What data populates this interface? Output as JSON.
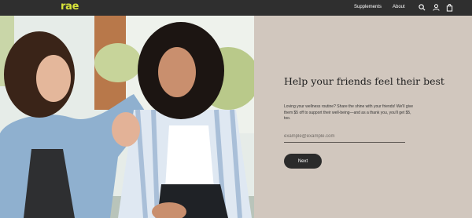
{
  "header": {
    "logo": "rae",
    "logo_color": "#d8e43a",
    "background": "#2f2f2f",
    "nav": [
      {
        "label": "Supplements"
      },
      {
        "label": "About"
      }
    ],
    "icons": [
      "search-icon",
      "account-icon",
      "cart-icon"
    ]
  },
  "hero": {
    "description_icon": "photo-two-women"
  },
  "panel": {
    "background": "#d1c7be",
    "headline": "Help your friends feel their best",
    "body": "Loving your wellness routine? Share the shine with your friends! We'll give them $5 off to support their well-being—and as a thank you, you'll get $5, too.",
    "email_placeholder": "example@example.com",
    "email_value": "",
    "next_label": "Next"
  }
}
